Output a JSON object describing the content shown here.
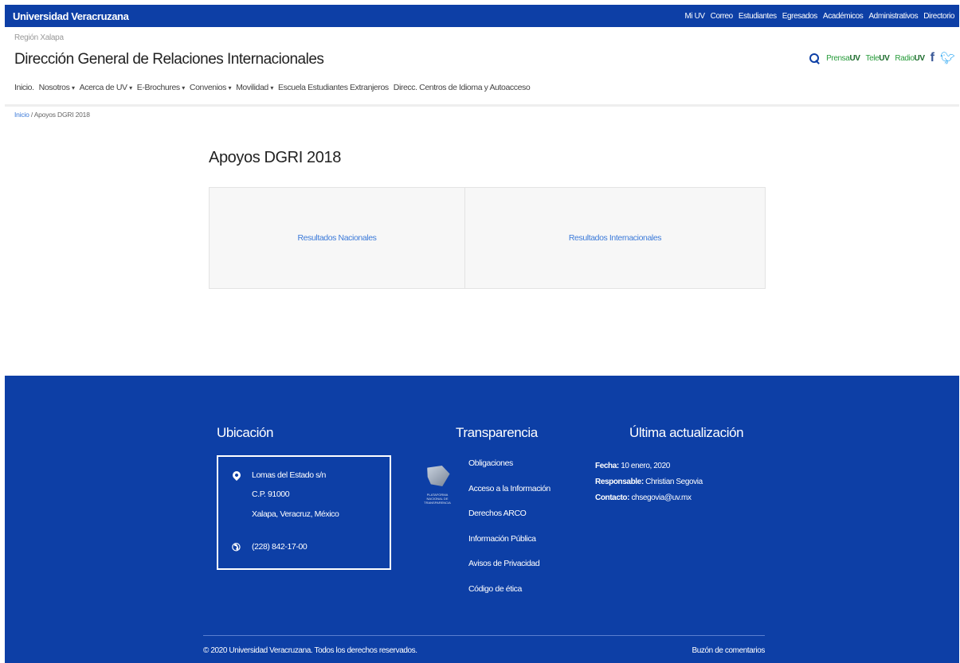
{
  "topbar": {
    "brand": "Universidad Veracruzana",
    "links": [
      "Mi UV",
      "Correo",
      "Estudiantes",
      "Egresados",
      "Académicos",
      "Administrativos",
      "Directorio"
    ]
  },
  "header": {
    "region": "Región Xalapa",
    "title": "Dirección General de Relaciones Internacionales",
    "media": [
      {
        "prefix": "Prensa",
        "suffix": "UV"
      },
      {
        "prefix": "Tele",
        "suffix": "UV"
      },
      {
        "prefix": "Radio",
        "suffix": "UV"
      }
    ],
    "icons": {
      "search": "search-icon",
      "facebook": "facebook-icon",
      "twitter": "twitter-icon"
    }
  },
  "nav": [
    {
      "label": "Inicio",
      "sep": ".",
      "caret": ""
    },
    {
      "label": "Nosotros",
      "sep": "",
      "caret": "▾"
    },
    {
      "label": "Acerca de UV",
      "sep": "",
      "caret": "▾"
    },
    {
      "label": "E-Brochures",
      "sep": "",
      "caret": "▾"
    },
    {
      "label": "Convenios",
      "sep": "",
      "caret": "▾"
    },
    {
      "label": "Movilidad",
      "sep": "",
      "caret": "▾"
    },
    {
      "label": "Escuela Estudiantes Extranjeros",
      "sep": "",
      "caret": ""
    },
    {
      "label": "Direcc. Centros de Idioma y Autoacceso",
      "sep": "",
      "caret": ""
    }
  ],
  "breadcrumb": {
    "home": "Inicio",
    "separator": "/",
    "current": "Apoyos DGRI 2018"
  },
  "main": {
    "heading": "Apoyos DGRI 2018",
    "cards": [
      "Resultados Nacionales",
      "Resultados Internacionales"
    ]
  },
  "footer": {
    "ubicacion": {
      "heading": "Ubicación",
      "address": [
        "Lomas del Estado s/n",
        "C.P. 91000",
        "Xalapa, Veracruz, México"
      ],
      "phone": "(228) 842-17-00"
    },
    "transparencia": {
      "heading": "Transparencia",
      "logo_text": "Plataforma Nacional de Transparencia",
      "links": [
        "Obligaciones",
        "Acceso a la Información",
        "Derechos ARCO",
        "Información Pública",
        "Avisos de Privacidad",
        "Código de ética"
      ]
    },
    "actualizacion": {
      "heading": "Última actualización",
      "fecha_label": "Fecha:",
      "fecha": "10 enero, 2020",
      "responsable_label": "Responsable:",
      "responsable": "Christian Segovia",
      "contacto_label": "Contacto:",
      "contacto": "chsegovia@uv.mx"
    },
    "copyright": "© 2020 Universidad Veracruzana. Todos los derechos reservados.",
    "buzon": "Buzón de comentarios"
  },
  "colors": {
    "brand_blue": "#0d3fa6",
    "link_blue": "#3d7bd9",
    "media_green": "#2a9d3d"
  }
}
